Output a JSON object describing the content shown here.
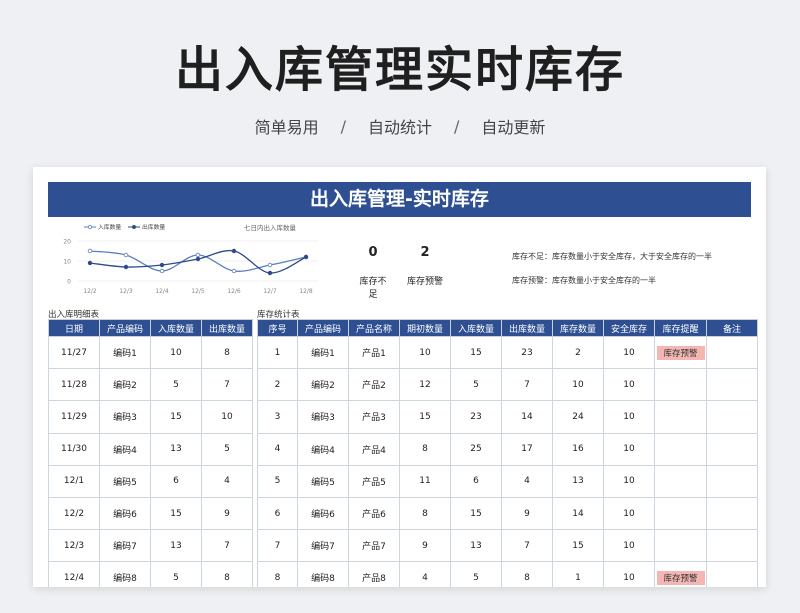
{
  "header": {
    "title": "出入库管理实时库存",
    "tags": [
      "简单易用",
      "自动统计",
      "自动更新"
    ],
    "separator": "/"
  },
  "sheet": {
    "banner": "出入库管理-实时库存",
    "chart_data": {
      "type": "line",
      "title": "七日内出入库数量",
      "categories": [
        "12/2",
        "12/3",
        "12/4",
        "12/5",
        "12/6",
        "12/7",
        "12/8"
      ],
      "series": [
        {
          "name": "入库数量",
          "values": [
            15,
            13,
            5,
            13,
            5,
            8,
            12
          ],
          "color": "#5b7fbd"
        },
        {
          "name": "出库数量",
          "values": [
            9,
            7,
            8,
            11,
            15,
            4,
            12
          ],
          "color": "#2e4a8a"
        }
      ],
      "ylim": [
        0,
        20
      ],
      "yticks": [
        "20",
        "10",
        "0"
      ]
    },
    "kpis": [
      {
        "value": "0",
        "label": "库存不足"
      },
      {
        "value": "2",
        "label": "库存预警"
      }
    ],
    "notes": [
      "库存不足：库存数量小于安全库存，大于安全库存的一半",
      "库存预警：库存数量小于安全库存的一半"
    ],
    "detail": {
      "label": "出入库明细表",
      "headers": [
        "日期",
        "产品编码",
        "入库数量",
        "出库数量"
      ],
      "rows": [
        [
          "11/27",
          "编码1",
          "10",
          "8"
        ],
        [
          "11/28",
          "编码2",
          "5",
          "7"
        ],
        [
          "11/29",
          "编码3",
          "15",
          "10"
        ],
        [
          "11/30",
          "编码4",
          "13",
          "5"
        ],
        [
          "12/1",
          "编码5",
          "6",
          "4"
        ],
        [
          "12/2",
          "编码6",
          "15",
          "9"
        ],
        [
          "12/3",
          "编码7",
          "13",
          "7"
        ],
        [
          "12/4",
          "编码8",
          "5",
          "8"
        ]
      ]
    },
    "stats": {
      "label": "库存统计表",
      "headers": [
        "序号",
        "产品编码",
        "产品名称",
        "期初数量",
        "入库数量",
        "出库数量",
        "库存数量",
        "安全库存",
        "库存提醒",
        "备注"
      ],
      "rows": [
        [
          "1",
          "编码1",
          "产品1",
          "10",
          "15",
          "23",
          "2",
          "10",
          "库存预警",
          ""
        ],
        [
          "2",
          "编码2",
          "产品2",
          "12",
          "5",
          "7",
          "10",
          "10",
          "",
          ""
        ],
        [
          "3",
          "编码3",
          "产品3",
          "15",
          "23",
          "14",
          "24",
          "10",
          "",
          ""
        ],
        [
          "4",
          "编码4",
          "产品4",
          "8",
          "25",
          "17",
          "16",
          "10",
          "",
          ""
        ],
        [
          "5",
          "编码5",
          "产品5",
          "11",
          "6",
          "4",
          "13",
          "10",
          "",
          ""
        ],
        [
          "6",
          "编码6",
          "产品6",
          "8",
          "15",
          "9",
          "14",
          "10",
          "",
          ""
        ],
        [
          "7",
          "编码7",
          "产品7",
          "9",
          "13",
          "7",
          "15",
          "10",
          "",
          ""
        ],
        [
          "8",
          "编码8",
          "产品8",
          "4",
          "5",
          "8",
          "1",
          "10",
          "库存预警",
          ""
        ]
      ]
    }
  }
}
